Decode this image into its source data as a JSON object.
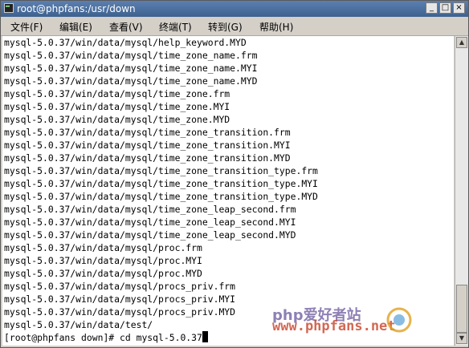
{
  "window": {
    "title": "root@phpfans:/usr/down",
    "minimize_label": "_",
    "maximize_label": "□",
    "close_label": "×"
  },
  "menu": [
    {
      "label": "文件(F)"
    },
    {
      "label": "编辑(E)"
    },
    {
      "label": "查看(V)"
    },
    {
      "label": "终端(T)"
    },
    {
      "label": "转到(G)"
    },
    {
      "label": "帮助(H)"
    }
  ],
  "terminal": {
    "lines": [
      "mysql-5.0.37/win/data/mysql/help_keyword.MYD",
      "mysql-5.0.37/win/data/mysql/time_zone_name.frm",
      "mysql-5.0.37/win/data/mysql/time_zone_name.MYI",
      "mysql-5.0.37/win/data/mysql/time_zone_name.MYD",
      "mysql-5.0.37/win/data/mysql/time_zone.frm",
      "mysql-5.0.37/win/data/mysql/time_zone.MYI",
      "mysql-5.0.37/win/data/mysql/time_zone.MYD",
      "mysql-5.0.37/win/data/mysql/time_zone_transition.frm",
      "mysql-5.0.37/win/data/mysql/time_zone_transition.MYI",
      "mysql-5.0.37/win/data/mysql/time_zone_transition.MYD",
      "mysql-5.0.37/win/data/mysql/time_zone_transition_type.frm",
      "mysql-5.0.37/win/data/mysql/time_zone_transition_type.MYI",
      "mysql-5.0.37/win/data/mysql/time_zone_transition_type.MYD",
      "mysql-5.0.37/win/data/mysql/time_zone_leap_second.frm",
      "mysql-5.0.37/win/data/mysql/time_zone_leap_second.MYI",
      "mysql-5.0.37/win/data/mysql/time_zone_leap_second.MYD",
      "mysql-5.0.37/win/data/mysql/proc.frm",
      "mysql-5.0.37/win/data/mysql/proc.MYI",
      "mysql-5.0.37/win/data/mysql/proc.MYD",
      "mysql-5.0.37/win/data/mysql/procs_priv.frm",
      "mysql-5.0.37/win/data/mysql/procs_priv.MYI",
      "mysql-5.0.37/win/data/mysql/procs_priv.MYD",
      "mysql-5.0.37/win/data/test/"
    ],
    "prompt": "[root@phpfans down]# cd mysql-5.0.37"
  },
  "watermark": {
    "line1": "php爱好者站",
    "line2": "www.phpfans.net"
  },
  "colors": {
    "titlebar": "#3e628f",
    "terminal_bg": "#ffffff",
    "terminal_fg": "#000000"
  }
}
